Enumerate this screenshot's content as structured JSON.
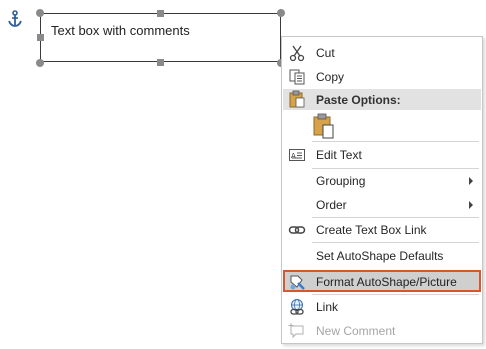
{
  "textbox": {
    "text": "Text box with comments"
  },
  "menu": {
    "cut": "Cut",
    "copy": "Copy",
    "paste_options": "Paste Options:",
    "edit_text": "Edit Text",
    "grouping": "Grouping",
    "order": "Order",
    "create_text_box_link": "Create Text Box Link",
    "set_autoshape_defaults": "Set AutoShape Defaults",
    "format_autoshape_picture": "Format AutoShape/Picture",
    "link": "Link",
    "new_comment": "New Comment"
  },
  "colors": {
    "highlight_border": "#d9552b",
    "highlight_bg": "#cfcfcf"
  },
  "icons": [
    "anchor-icon",
    "scissors-icon",
    "copy-icon",
    "paste-icon",
    "paste-keep-text-icon",
    "edit-text-icon",
    "chain-link-icon",
    "format-shape-icon",
    "hyperlink-icon",
    "new-comment-icon"
  ]
}
